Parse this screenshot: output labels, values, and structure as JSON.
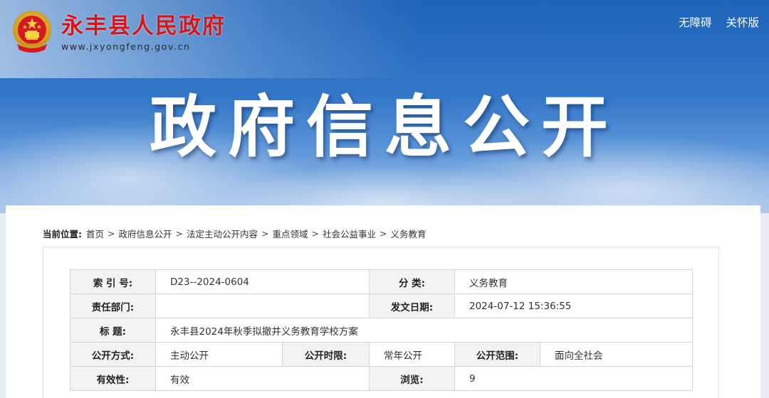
{
  "header": {
    "site_name": "永丰县人民政府",
    "site_url": "www.jxyongfeng.gov.cn",
    "emblem_icon": "national-emblem-icon",
    "links": [
      "无障碍",
      "关怀版"
    ]
  },
  "banner": {
    "title": "政府信息公开"
  },
  "breadcrumb": {
    "label": "当前位置:",
    "items": [
      "首页",
      "政府信息公开",
      "法定主动公开内容",
      "重点领域",
      "社会公益事业",
      "义务教育"
    ],
    "separator": ">"
  },
  "meta": {
    "index_label": "索 引 号:",
    "index_value": "D23--2024-0604",
    "category_label": "分 类:",
    "category_value": "义务教育",
    "dept_label": "责任部门:",
    "dept_value": "",
    "date_label": "发文日期:",
    "date_value": "2024-07-12 15:36:55",
    "title_label": "标 题:",
    "title_value": "永丰县2024年秋季拟撤并义务教育学校方案",
    "method_label": "公开方式:",
    "method_value": "主动公开",
    "period_label": "公开时限:",
    "period_value": "常年公开",
    "scope_label": "公开范围:",
    "scope_value": "面向全社会",
    "validity_label": "有效性:",
    "validity_value": "有效",
    "views_label": "浏览:",
    "views_value": "9"
  },
  "colors": {
    "site_name": "#d6151b",
    "banner_top": "#1d63b8",
    "label_bg": "#f3f3f3",
    "border": "#d6d6d6"
  }
}
